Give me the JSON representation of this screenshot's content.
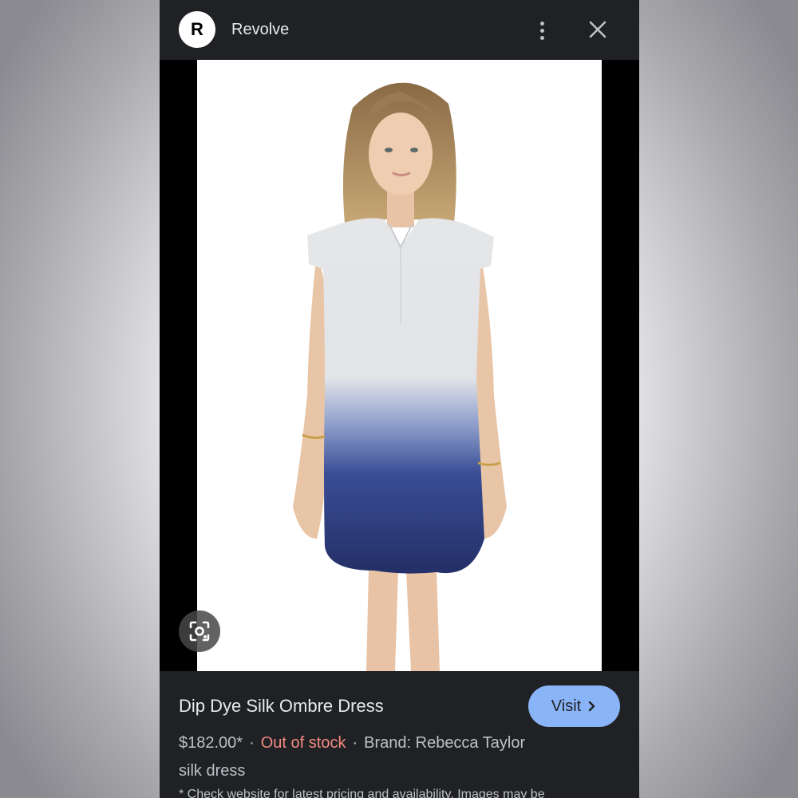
{
  "header": {
    "logo_letter": "R",
    "site_name": "Revolve",
    "menu_icon": "more-vert-icon",
    "close_icon": "close-icon"
  },
  "image": {
    "alt": "Dip Dye Silk Ombre Dress",
    "lens_icon": "lens-search-icon",
    "dress_top_color": "#e4e6e8",
    "dress_bottom_color": "#26346f"
  },
  "product": {
    "title": "Dip Dye Silk Ombre Dress",
    "visit_label": "Visit",
    "price": "$182.00*",
    "stock_status": "Out of stock",
    "brand": "Brand: Rebecca Taylor",
    "category": "silk dress",
    "disclaimer": "* Check website for latest pricing and availability. Images may be"
  },
  "colors": {
    "panel": "#202124",
    "accent": "#8ab4f8",
    "out_of_stock": "#f28b82"
  }
}
